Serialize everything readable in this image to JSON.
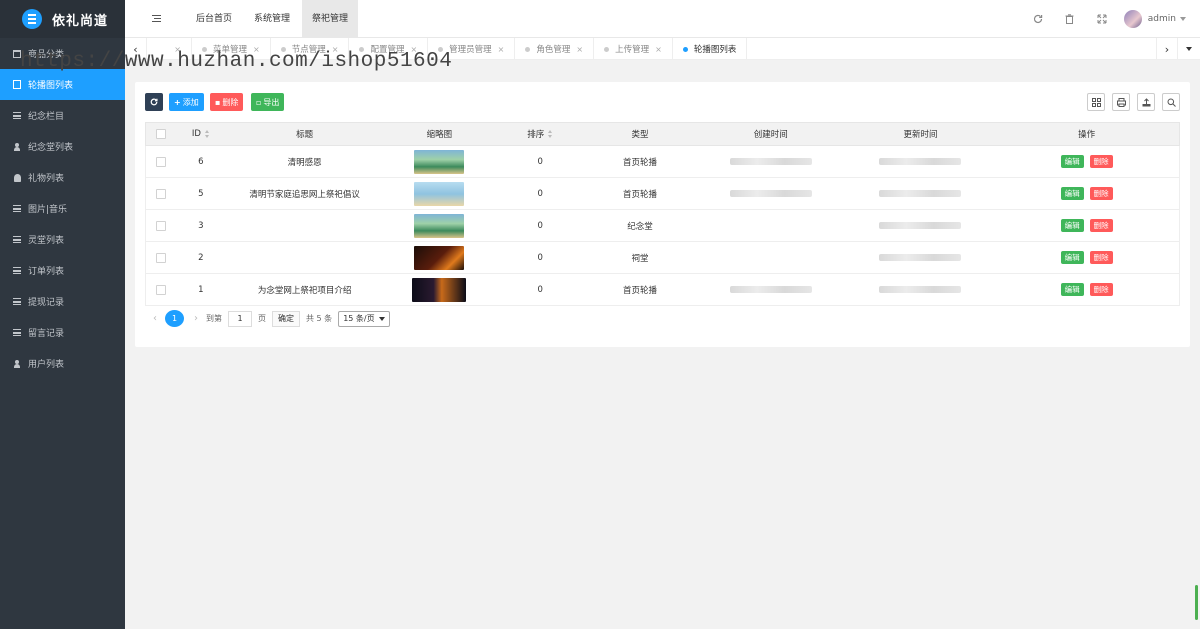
{
  "brand": {
    "name": "依礼尚道"
  },
  "sidebar": {
    "items": [
      {
        "label": "商品分类",
        "icon": "calendar-icon"
      },
      {
        "label": "轮播图列表",
        "icon": "document-icon",
        "active": true
      },
      {
        "label": "纪念栏目",
        "icon": "list-icon"
      },
      {
        "label": "纪念堂列表",
        "icon": "user-icon"
      },
      {
        "label": "礼物列表",
        "icon": "bell-icon"
      },
      {
        "label": "图片|音乐",
        "icon": "list-icon"
      },
      {
        "label": "灵堂列表",
        "icon": "list-icon"
      },
      {
        "label": "订单列表",
        "icon": "list-icon"
      },
      {
        "label": "提现记录",
        "icon": "list-icon"
      },
      {
        "label": "留言记录",
        "icon": "list-icon"
      },
      {
        "label": "用户列表",
        "icon": "user-icon"
      }
    ]
  },
  "topnav": {
    "items": [
      "后台首页",
      "系统管理",
      "祭祀管理"
    ],
    "active_index": 2
  },
  "header": {
    "user": "admin"
  },
  "tabs": {
    "items": [
      "菜单管理",
      "节点管理",
      "配置管理",
      "管理员管理",
      "角色管理",
      "上传管理",
      "轮播图列表"
    ],
    "active_index": 6,
    "prev_arrow": "‹",
    "next_arrow": "›",
    "close_glyph": "×"
  },
  "watermark": "https://www.huzhan.com/ishop51604",
  "toolbar": {
    "add_label": "添加",
    "delete_label": "删除",
    "export_label": "导出"
  },
  "table": {
    "columns": [
      "ID",
      "标题",
      "缩略图",
      "排序",
      "类型",
      "创建时间",
      "更新时间",
      "操作"
    ],
    "rows": [
      {
        "id": "6",
        "title": "清明感恩",
        "sort": "0",
        "type": "首页轮播",
        "thumb": "green"
      },
      {
        "id": "5",
        "title": "清明节家庭追思网上祭祀倡议",
        "sort": "0",
        "type": "首页轮播",
        "thumb": "blue"
      },
      {
        "id": "3",
        "title": "",
        "sort": "0",
        "type": "纪念堂",
        "thumb": "green"
      },
      {
        "id": "2",
        "title": "",
        "sort": "0",
        "type": "祠堂",
        "thumb": "dark"
      },
      {
        "id": "1",
        "title": "为念堂网上祭祀项目介绍",
        "sort": "0",
        "type": "首页轮播",
        "thumb": "night"
      }
    ],
    "edit_label": "编辑",
    "delete_label": "删除"
  },
  "pagination": {
    "current": "1",
    "goto_prefix": "到第",
    "goto_value": "1",
    "goto_suffix": "页",
    "confirm_label": "确定",
    "total_text": "共 5 条",
    "page_size": "15 条/页"
  },
  "colors": {
    "accent": "#1e9fff",
    "sidebar_bg": "#2f3740",
    "success": "#3fb65a",
    "danger": "#ff5a5a"
  }
}
